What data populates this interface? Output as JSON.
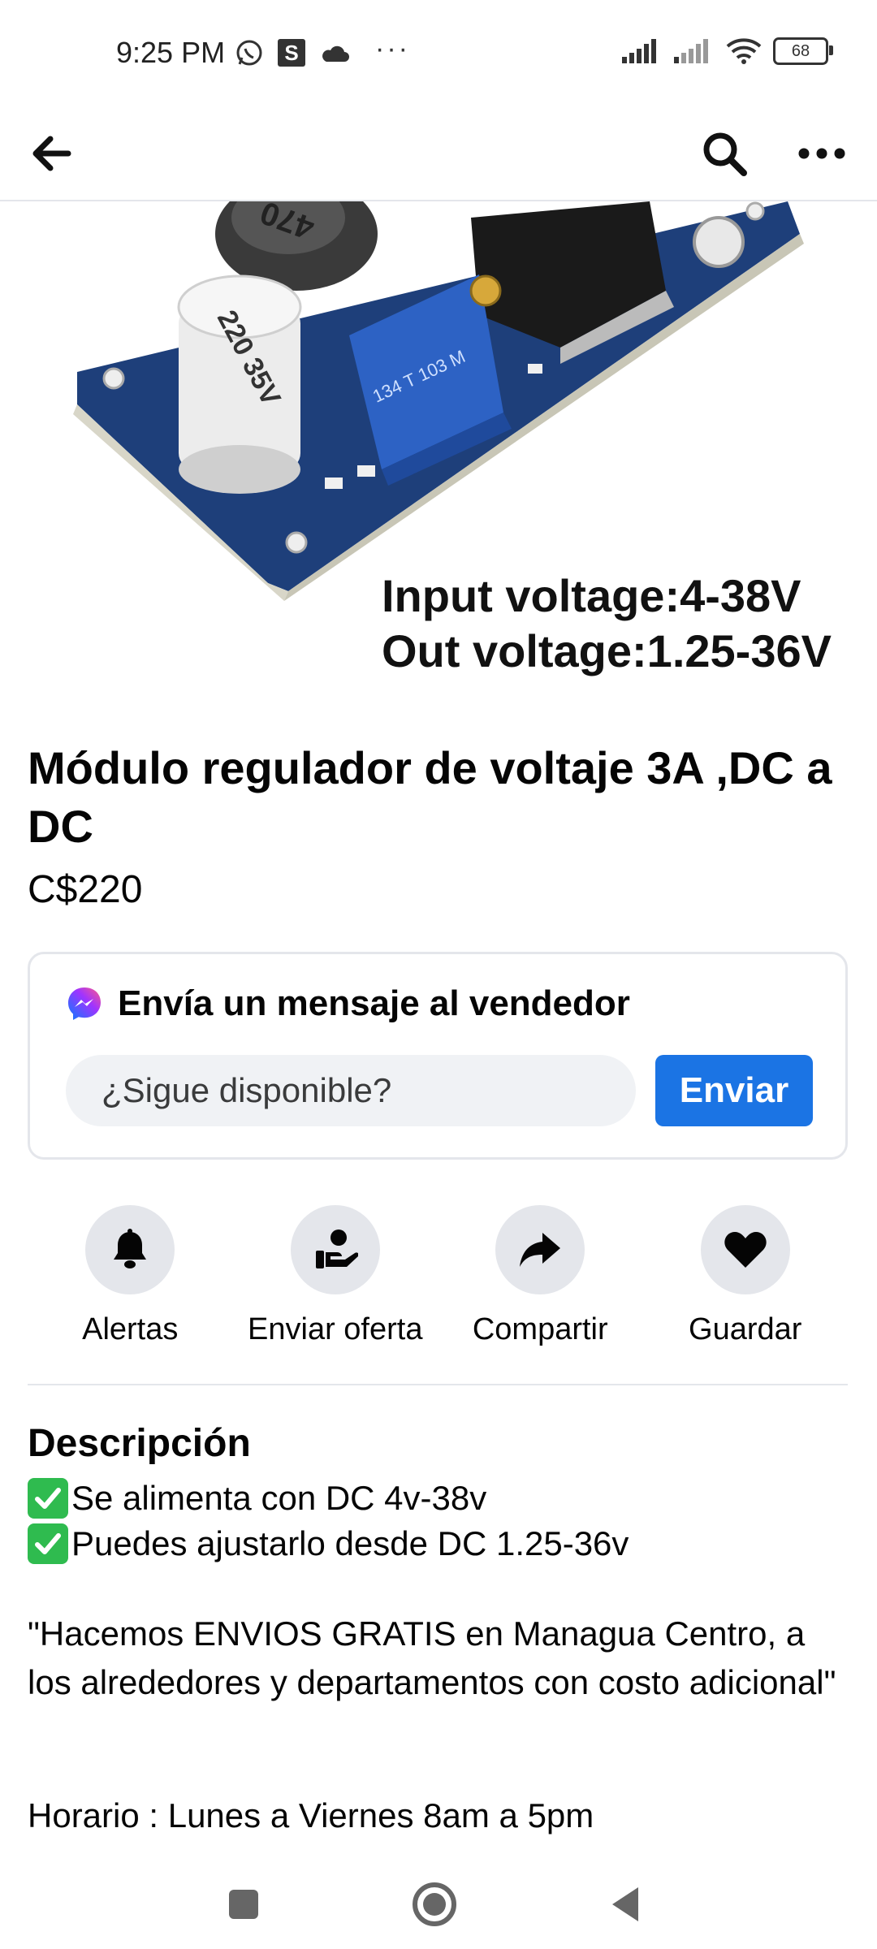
{
  "status_bar": {
    "time": "9:25 PM",
    "s_badge": "S",
    "more": "···",
    "battery": "68"
  },
  "product": {
    "image_caption_line1": "Input voltage:4-38V",
    "image_caption_line2": "Out voltage:1.25-36V",
    "pcb_cap_label": "220 35V",
    "pcb_inductor_label": "470",
    "pcb_pot_label": "134 T 103 M",
    "title": "Módulo regulador de voltaje 3A ,DC a DC",
    "price": "C$220"
  },
  "message_card": {
    "title": "Envía un mensaje al vendedor",
    "input_value": "¿Sigue disponible?",
    "send_label": "Enviar"
  },
  "actions": [
    {
      "label": "Alertas",
      "icon": "bell-icon"
    },
    {
      "label": "Enviar oferta",
      "icon": "offer-hand-icon"
    },
    {
      "label": "Compartir",
      "icon": "share-arrow-icon"
    },
    {
      "label": "Guardar",
      "icon": "heart-icon"
    }
  ],
  "description": {
    "heading": "Descripción",
    "bullet1": "Se alimenta con DC 4v-38v",
    "bullet2": "Puedes ajustarlo desde DC 1.25-36v",
    "paragraph": "\"Hacemos ENVIOS GRATIS en Managua Centro, a los alrededores y departamentos con costo adicional\"",
    "hours": "Horario : Lunes a Viernes 8am a 5pm"
  },
  "colors": {
    "accent": "#1b74e4",
    "check_green": "#2fbb4f",
    "pcb_blue": "#1e3f7a",
    "divider": "#e4e6eb"
  }
}
